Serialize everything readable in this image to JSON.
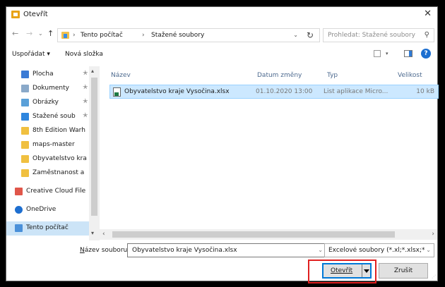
{
  "window": {
    "title": "Otevřít",
    "close_glyph": "✕"
  },
  "nav": {
    "back_glyph": "←",
    "forward_glyph": "→",
    "recent_glyph": "⌄",
    "up_glyph": "↑",
    "breadcrumb": [
      "Tento počítač",
      "Stažené soubory"
    ],
    "separator": "›",
    "dropdown_glyph": "⌄",
    "refresh_glyph": "↻"
  },
  "search": {
    "placeholder": "Prohledat: Stažené soubory",
    "icon_glyph": "⚲"
  },
  "toolbar": {
    "organize_label": "Uspořádat ▾",
    "new_folder_label": "Nová složka",
    "help_glyph": "?"
  },
  "sidebar": {
    "items": [
      {
        "label": "Plocha",
        "pinned": "✭",
        "color": "#3a7bd5"
      },
      {
        "label": "Dokumenty",
        "pinned": "✭",
        "color": "#8aa9c9"
      },
      {
        "label": "Obrázky",
        "pinned": "✭",
        "color": "#5aa0d8"
      },
      {
        "label": "Stažené soub",
        "pinned": "✭",
        "color": "#2f86de"
      },
      {
        "label": "8th Edition Warh",
        "pinned": "",
        "color": "#f0c040"
      },
      {
        "label": "maps-master",
        "pinned": "",
        "color": "#f0c040"
      },
      {
        "label": "Obyvatelstvo kra",
        "pinned": "",
        "color": "#f0c040"
      },
      {
        "label": "Zaměstnanost a",
        "pinned": "",
        "color": "#f0c040"
      },
      {
        "label": "Creative Cloud File",
        "pinned": "",
        "color": "#e0564a"
      },
      {
        "label": "OneDrive",
        "pinned": "",
        "color": "#1e6fd0"
      },
      {
        "label": "Tento počítač",
        "pinned": "",
        "color": "#4a90d9"
      }
    ],
    "scroll_up": "▴",
    "scroll_down": "▾"
  },
  "columns": {
    "name": "Název",
    "date": "Datum změny",
    "type": "Typ",
    "size": "Velikost"
  },
  "files": [
    {
      "name": "Obyvatelstvo kraje Vysočina.xlsx",
      "date": "01.10.2020 13:00",
      "type": "List aplikace Micro...",
      "size": "10 kB"
    }
  ],
  "hscroll": {
    "left": "‹",
    "right": "›"
  },
  "footer": {
    "filename_label_prefix": "N",
    "filename_label_rest": "ázev souboru:",
    "filename_value": "Obyvatelstvo kraje Vysočina.xlsx",
    "filetype_value": "Excelové soubory (*.xl;*.xlsx;*.xls",
    "open_label": "Otevřít",
    "cancel_label": "Zrušit",
    "dropdown_glyph": "⌄"
  },
  "colors": {
    "selection": "#cce8ff",
    "accent": "#0078d7",
    "highlight": "#e02020"
  }
}
